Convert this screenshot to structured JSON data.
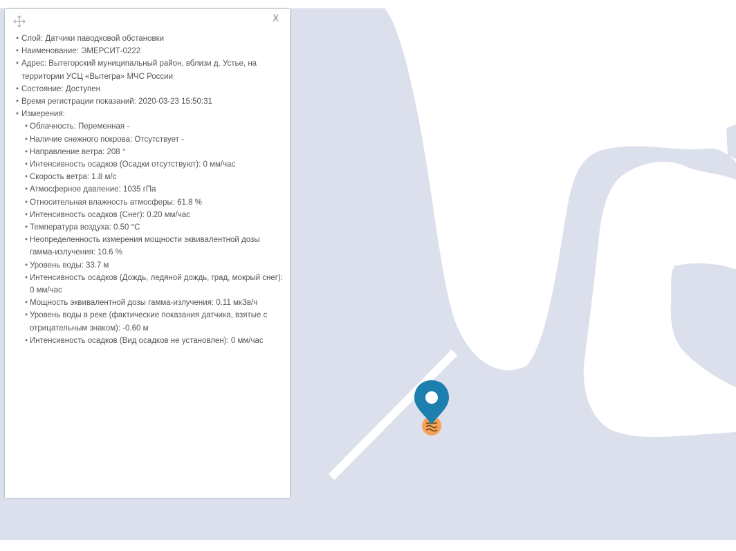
{
  "popup": {
    "close_label": "X",
    "fields": [
      {
        "level": 1,
        "text": "Слой: Датчики паводковой обстановки"
      },
      {
        "level": 1,
        "text": "Наименование: ЭМЕРСИТ-0222"
      },
      {
        "level": 1,
        "text": "Адрес: Вытегорский муниципальный район, вблизи д. Устье, на территории УСЦ «Вытегра» МЧС России"
      },
      {
        "level": 1,
        "text": "Состояние: Доступен"
      },
      {
        "level": 1,
        "text": "Время регистрации показаний: 2020-03-23 15:50:31"
      },
      {
        "level": 1,
        "text": "Измерения:"
      },
      {
        "level": 2,
        "text": "Облачность: Переменная -"
      },
      {
        "level": 2,
        "text": "Наличие снежного покрова: Отсутствует -"
      },
      {
        "level": 2,
        "text": "Направление ветра: 208 °"
      },
      {
        "level": 2,
        "text": "Интенсивность осадков (Осадки отсутствуют): 0 мм/час"
      },
      {
        "level": 2,
        "text": "Скорость ветра: 1.8 м/с"
      },
      {
        "level": 2,
        "text": "Атмосферное давление: 1035 гПа"
      },
      {
        "level": 2,
        "text": "Относительная влажность атмосферы: 61.8 %"
      },
      {
        "level": 2,
        "text": "Интенсивность осадков (Снег): 0.20 мм/час"
      },
      {
        "level": 2,
        "text": "Температура воздуха: 0.50 °C"
      },
      {
        "level": 2,
        "text": "Неопределенность измерения мощности эквивалентной дозы гамма-излучения: 10.6 %"
      },
      {
        "level": 2,
        "text": "Уровень воды: 33.7 м"
      },
      {
        "level": 2,
        "text": "Интенсивность осадков (Дождь, ледяной дождь, град, мокрый снег): 0 мм/час"
      },
      {
        "level": 2,
        "text": "Мощность эквивалентной дозы гамма-излучения: 0.11 мкЗв/ч"
      },
      {
        "level": 2,
        "text": "Уровень воды в реке (фактические показания датчика, взятые с отрицательным знаком): -0.60 м"
      },
      {
        "level": 2,
        "text": "Интенсивность осадков (Вид осадков не установлен): 0 мм/час"
      }
    ]
  },
  "map": {
    "water_color": "#dce0ec",
    "land_color": "#ffffff",
    "marker": {
      "icon": "map-pin-icon",
      "color": "#1d7fb0",
      "badge_icon": "flood-sensor-icon",
      "badge_color": "#f4a259"
    }
  }
}
